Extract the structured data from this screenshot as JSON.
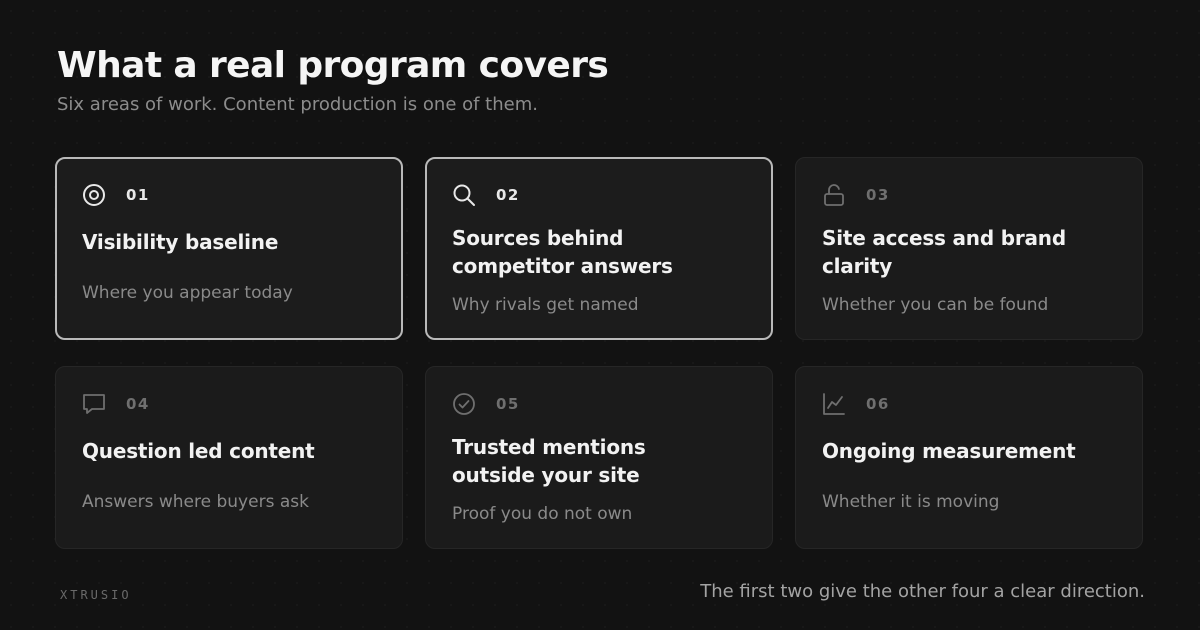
{
  "header": {
    "title": "What a real program covers",
    "subtitle": "Six areas of work. Content production is one of them."
  },
  "cards": [
    {
      "number": "01",
      "icon": "target-icon",
      "title": "Visibility baseline",
      "description": "Where you appear today",
      "active": true
    },
    {
      "number": "02",
      "icon": "search-icon",
      "title": "Sources behind competitor answers",
      "description": "Why rivals get named",
      "active": true
    },
    {
      "number": "03",
      "icon": "unlock-icon",
      "title": "Site access and brand clarity",
      "description": "Whether you can be found",
      "active": false
    },
    {
      "number": "04",
      "icon": "message-icon",
      "title": "Question led content",
      "description": "Answers where buyers ask",
      "active": false
    },
    {
      "number": "05",
      "icon": "check-circle-icon",
      "title": "Trusted mentions outside your site",
      "description": "Proof you do not own",
      "active": false
    },
    {
      "number": "06",
      "icon": "line-chart-icon",
      "title": "Ongoing measurement",
      "description": "Whether it is moving",
      "active": false
    }
  ],
  "footer": {
    "brand": "XTRUSIO",
    "note": "The first two give the other four a clear direction."
  },
  "colors": {
    "background": "#121212",
    "card": "#1b1b1b",
    "active_border": "#b9b9b9",
    "muted_text": "#8a8a8a"
  }
}
